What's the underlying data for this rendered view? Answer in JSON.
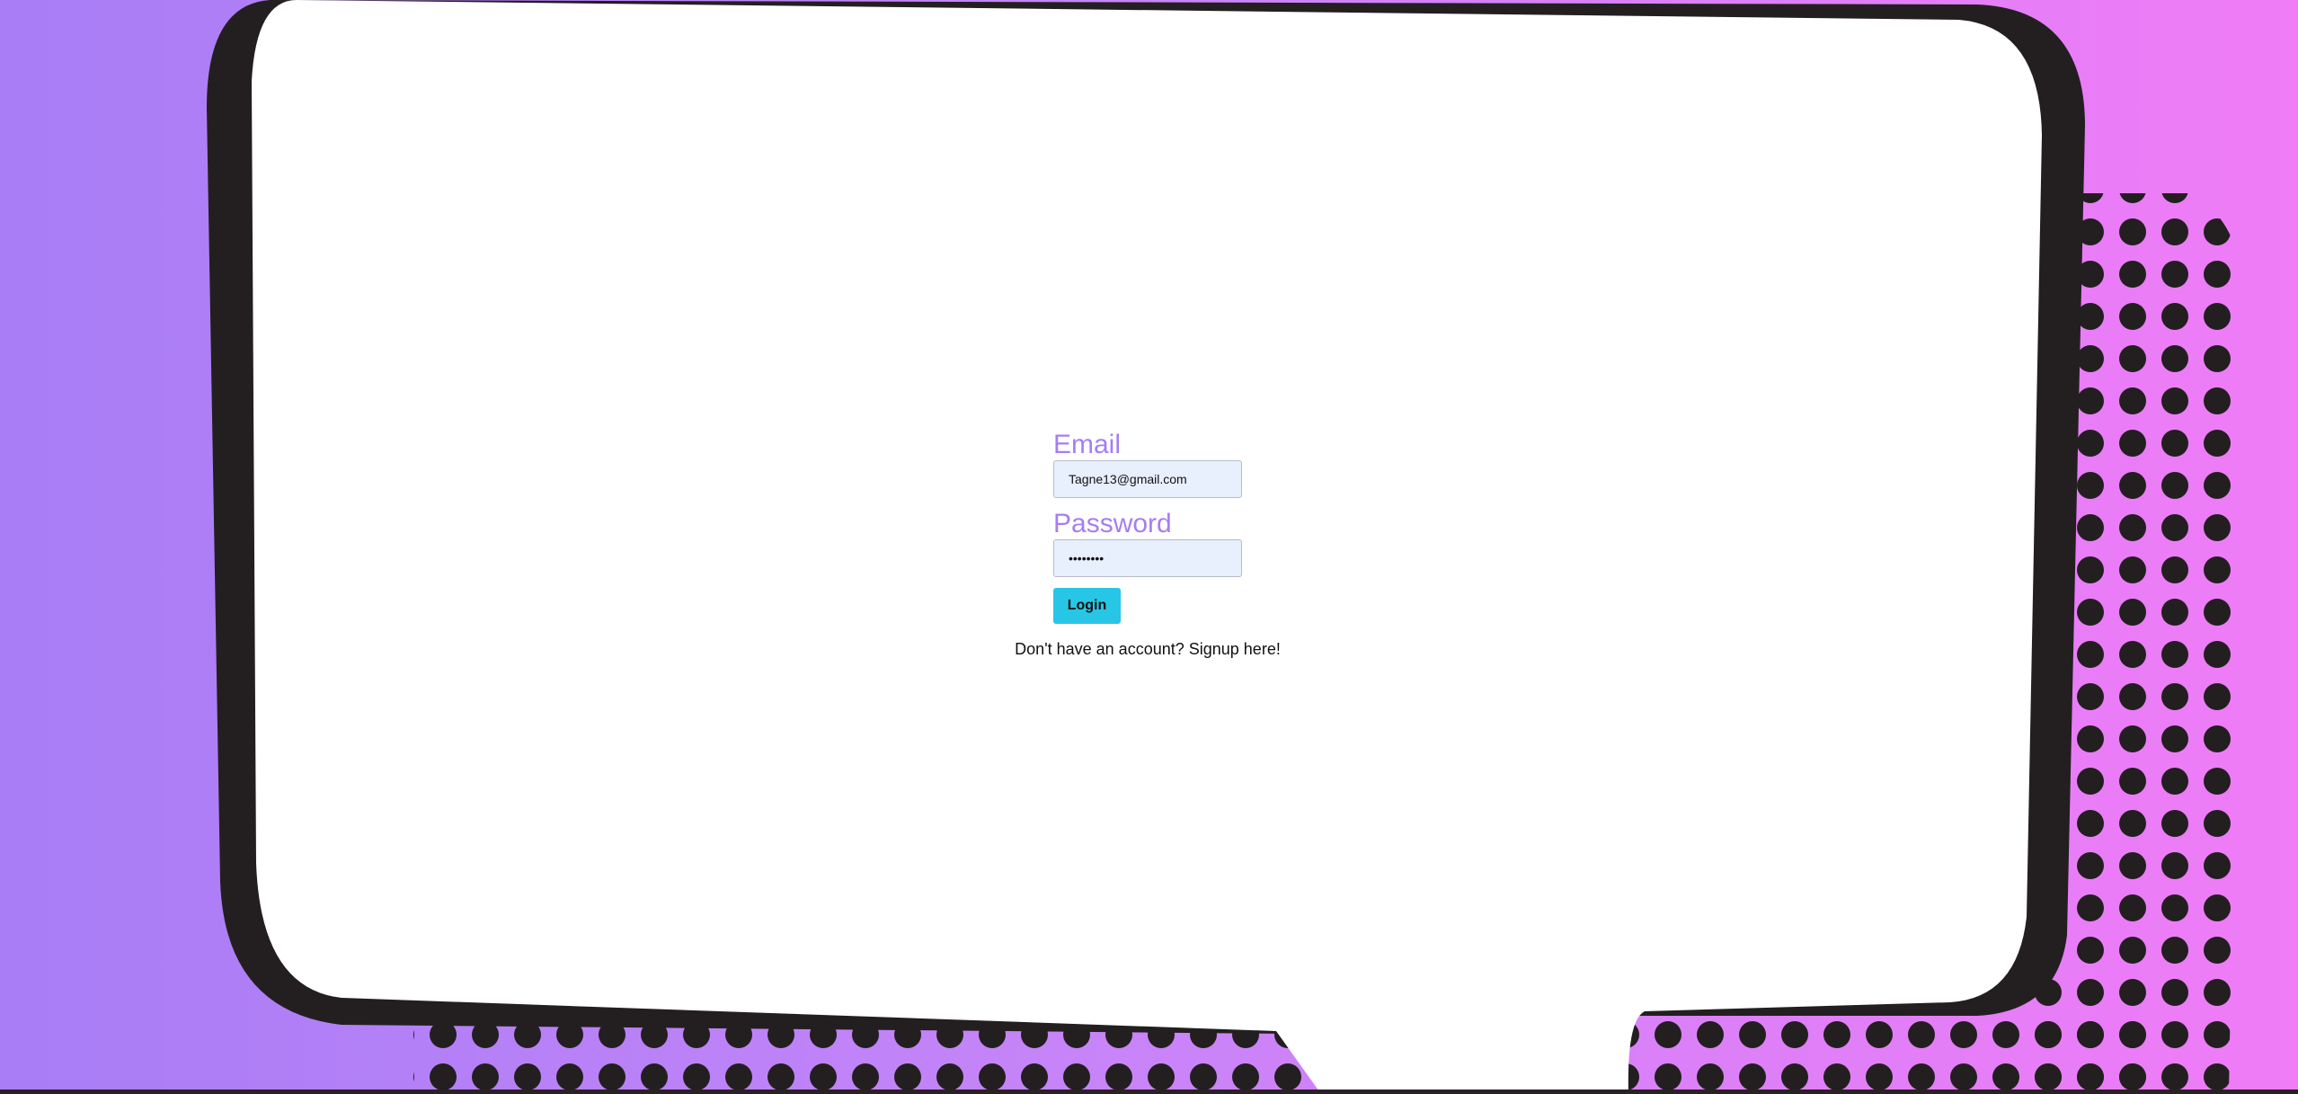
{
  "colors": {
    "background_left": "#a87df6",
    "background_right": "#f07cf7",
    "label": "#a67ef1",
    "input_bg": "#e8effd",
    "button_bg": "#27c6e6",
    "bubble_outline": "#231f20",
    "bubble_fill": "#ffffff"
  },
  "background": {
    "icon": "comic-speech-bubble-illustration"
  },
  "login": {
    "email_label": "Email",
    "email_value": "Tagne13@gmail.com",
    "password_label": "Password",
    "password_value": "••••••••",
    "button_label": "Login"
  },
  "signup": {
    "prompt": "Don't have an account? ",
    "link": "Signup here!"
  }
}
